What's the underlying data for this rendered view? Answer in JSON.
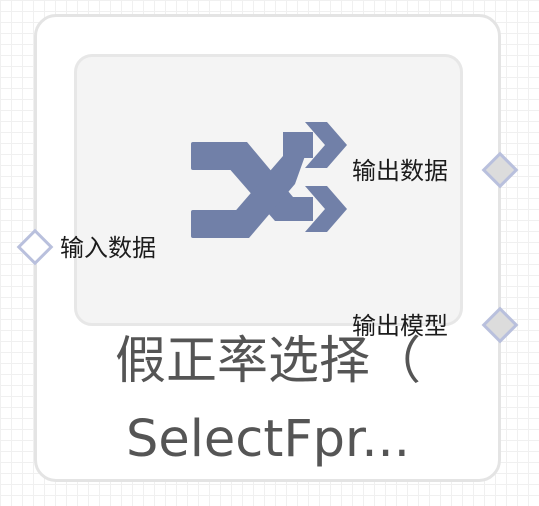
{
  "node": {
    "icon": "shuffle-icon",
    "icon_color": "#7180a8",
    "title_line1": "假正率选择（",
    "title_line2": "SelectFpr..."
  },
  "ports": {
    "input_label": "输入数据",
    "output_data_label": "输出数据",
    "output_model_label": "输出模型"
  }
}
